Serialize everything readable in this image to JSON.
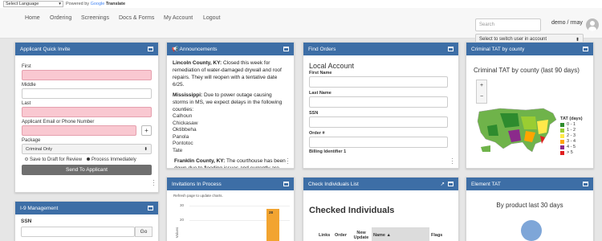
{
  "translate": {
    "language_select": "Select Language",
    "powered_by": "Powered by",
    "google": "Google",
    "translate": "Translate"
  },
  "nav": {
    "items": [
      "Home",
      "Ordering",
      "Screenings",
      "Docs & Forms",
      "My Account",
      "Logout"
    ],
    "search_placeholder": "Search",
    "user": "demo / rmay",
    "switch_user": "Select to switch user in account"
  },
  "quick_invite": {
    "title": "Applicant Quick Invite",
    "first": "First",
    "middle": "Middle",
    "last": "Last",
    "email_phone": "Applicant Email or Phone Number",
    "add": "+",
    "package_label": "Package",
    "package_value": "Criminal Only",
    "save_draft": "Save to Draft for Review",
    "process_now": "Process Immediately",
    "send": "Send To Applicant"
  },
  "announcements": {
    "title": "Announcements",
    "p1_bold": "Lincoln County, KY:",
    "p1_text": " Closed this week for remediation of water-damaged drywall and roof repairs. They will reopen with a tentative date 6/25.",
    "p2_bold": "Mississippi:",
    "p2_text": " Due to power outage causing storms in MS, we expect delays in the following counties:",
    "counties": [
      "Calhoun",
      "Chickasaw",
      "Oktibbeha",
      "Panola",
      "Pontotoc",
      "Tate"
    ],
    "p3_bold": "Franklin County, KY:",
    "p3_text": " The courthouse has been down due to flooding issues and currently are"
  },
  "find_orders": {
    "title": "Find Orders",
    "subtitle": "Local Account",
    "first_name": "First Name",
    "last_name": "Last Name",
    "ssn": "SSN",
    "order": "Order #",
    "billing": "Billing Identifier 1"
  },
  "criminal_tat": {
    "title": "Criminal TAT by county",
    "chart_title": "Criminal TAT by county  (last 90 days)",
    "legend_title": "TAT (days)",
    "legend": [
      {
        "label": "0 - 1",
        "color": "#2e8b2e"
      },
      {
        "label": "1 - 2",
        "color": "#9acd32"
      },
      {
        "label": "2 - 3",
        "color": "#ffe94a"
      },
      {
        "label": "3 - 4",
        "color": "#ffa500"
      },
      {
        "label": "4 - 5",
        "color": "#8b2a8b"
      },
      {
        "label": "> 5",
        "color": "#e02020"
      }
    ]
  },
  "i9": {
    "title": "I-9 Management",
    "ssn": "SSN",
    "go": "Go"
  },
  "invitations": {
    "title": "Invitations In Process",
    "refresh_note": "Refresh page to update charts.",
    "y_tick_top": "30",
    "y_tick_mid": "20",
    "axis_label": "Values"
  },
  "chart_data": {
    "type": "bar",
    "categories": [
      ""
    ],
    "values": [
      28
    ],
    "title": "",
    "xlabel": "",
    "ylabel": "Values",
    "ylim": [
      0,
      30
    ],
    "data_labels": [
      "28"
    ]
  },
  "check_individuals": {
    "title": "Check Individuals List",
    "heading": "Checked Individuals",
    "columns": [
      "Links",
      "Order",
      "New Update",
      "Name ▲",
      "Flags"
    ]
  },
  "element_tat": {
    "title": "Element TAT",
    "subtitle": "By product last 30 days"
  }
}
